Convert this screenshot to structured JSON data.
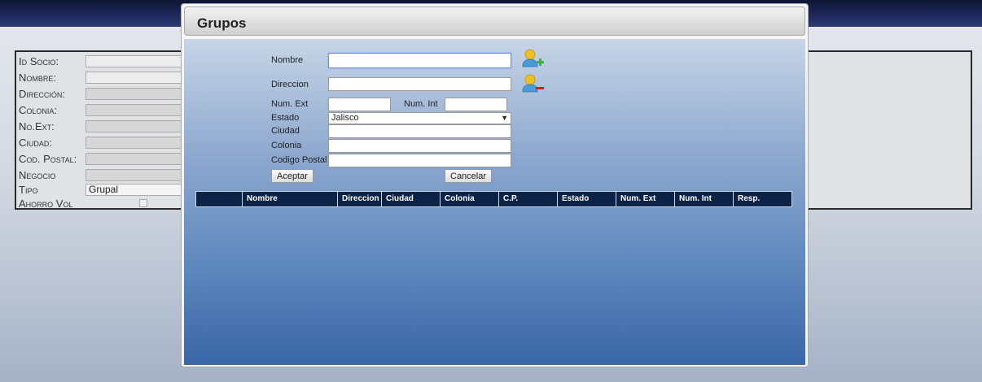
{
  "background_form": {
    "rows": [
      {
        "label": "Id Socio:",
        "value": ""
      },
      {
        "label": "Nombre:",
        "value": ""
      },
      {
        "label": "Dirección:",
        "value": ""
      },
      {
        "label": "Colonia:",
        "value": ""
      },
      {
        "label": "No.Ext:",
        "value": ""
      },
      {
        "label": "Ciudad:",
        "value": ""
      },
      {
        "label": "Cod. Postal:",
        "value": ""
      },
      {
        "label": "Negocio",
        "value": ""
      },
      {
        "label": "Tipo",
        "value": "Grupal"
      },
      {
        "label": "Ahorro Vol",
        "value": ""
      }
    ]
  },
  "dialog": {
    "title": "Grupos",
    "form": {
      "nombre_label": "Nombre",
      "nombre_value": "",
      "direccion_label": "Direccion",
      "direccion_value": "",
      "num_ext_label": "Num. Ext",
      "num_ext_value": "",
      "num_int_label": "Num. Int",
      "num_int_value": "",
      "estado_label": "Estado",
      "estado_value": "Jalisco",
      "ciudad_label": "Ciudad",
      "ciudad_value": "",
      "colonia_label": "Colonia",
      "colonia_value": "",
      "codigo_postal_label": "Codigo Postal",
      "codigo_postal_value": "",
      "aceptar_label": "Aceptar",
      "cancelar_label": "Cancelar"
    },
    "icons": {
      "add": "add-user-icon",
      "remove": "remove-user-icon"
    },
    "grid": {
      "columns": [
        "",
        "Nombre",
        "Direccion",
        "Ciudad",
        "Colonia",
        "C.P.",
        "Estado",
        "Num. Ext",
        "Num. Int",
        "Resp."
      ]
    }
  },
  "colors": {
    "topbar": "#1a2452",
    "grid_header": "#0d2247",
    "dialog_gradient_top": "#c7d5e6",
    "dialog_gradient_bottom": "#3a66a6",
    "add_badge": "#3cb043",
    "remove_badge": "#d02020"
  }
}
